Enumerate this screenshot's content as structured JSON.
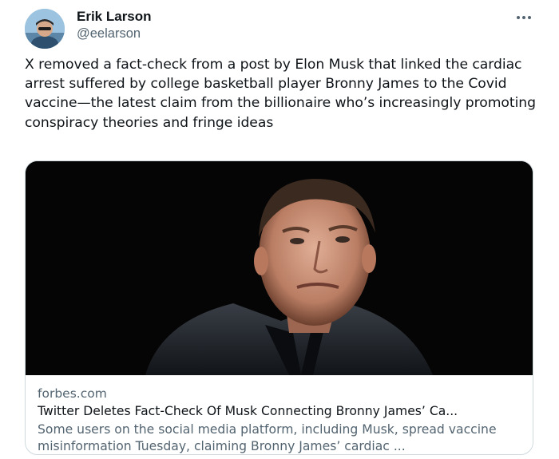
{
  "author": {
    "name": "Erik Larson",
    "handle": "@eelarson",
    "avatar_icon": "profile-photo"
  },
  "tweet": {
    "text": "X removed a fact-check from a post by Elon Musk that linked the cardiac arrest suffered by college basketball player Bronny James to the Covid vaccine—the latest claim from the billionaire who’s increasingly promoting conspiracy theories and fringe ideas"
  },
  "menu": {
    "more_icon": "more-horizontal-icon"
  },
  "link_card": {
    "domain": "forbes.com",
    "title": "Twitter Deletes Fact-Check Of Musk Connecting Bronny James’ Ca...",
    "description": "Some users on the social media platform, including Musk, spread vaccine misinformation Tuesday, claiming Bronny James’ cardiac ..."
  },
  "colors": {
    "text_primary": "#0f1419",
    "text_secondary": "#536471",
    "border": "#cfd9de",
    "image_background": "#050505"
  }
}
